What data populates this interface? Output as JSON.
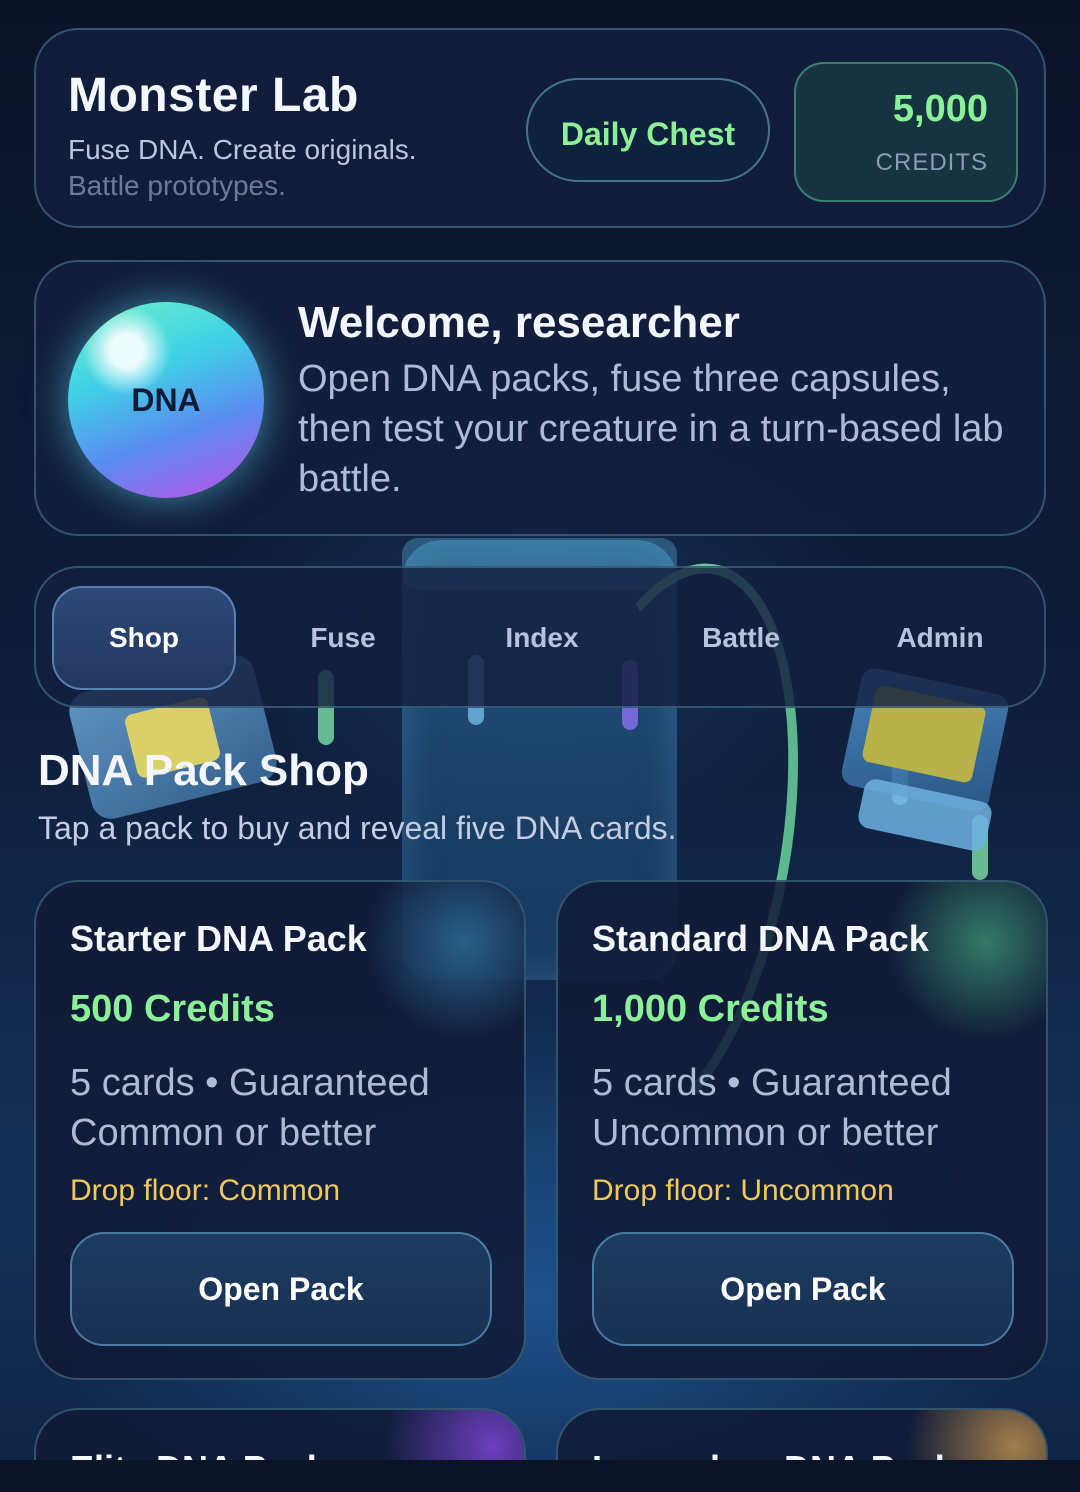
{
  "header": {
    "title": "Monster Lab",
    "tagline_line1": "Fuse DNA. Create originals.",
    "tagline_line2": "Battle prototypes.",
    "daily_chest_label": "Daily Chest",
    "credits_value": "5,000",
    "credits_label": "CREDITS"
  },
  "welcome": {
    "orb_label": "DNA",
    "title": "Welcome, researcher",
    "text": "Open DNA packs, fuse three capsules, then test your creature in a turn-based lab battle."
  },
  "tabs": [
    {
      "label": "Shop",
      "active": true
    },
    {
      "label": "Fuse",
      "active": false
    },
    {
      "label": "Index",
      "active": false
    },
    {
      "label": "Battle",
      "active": false
    },
    {
      "label": "Admin",
      "active": false
    }
  ],
  "shop": {
    "title": "DNA Pack Shop",
    "subtitle": "Tap a pack to buy and reveal five DNA cards.",
    "packs": [
      {
        "name": "Starter DNA Pack",
        "price": "500 Credits",
        "description": "5 cards • Guaranteed Common or better",
        "drop_floor": "Drop floor: Common",
        "button": "Open Pack"
      },
      {
        "name": "Standard DNA Pack",
        "price": "1,000 Credits",
        "description": "5 cards • Guaranteed Uncommon or better",
        "drop_floor": "Drop floor: Uncommon",
        "button": "Open Pack"
      },
      {
        "name": "Elite DNA Pack"
      },
      {
        "name": "Legendary DNA Pack"
      }
    ]
  },
  "colors": {
    "accent_green": "#8cf098",
    "drop_floor_gold": "#f0c95a",
    "panel_bg": "#121e3e"
  }
}
